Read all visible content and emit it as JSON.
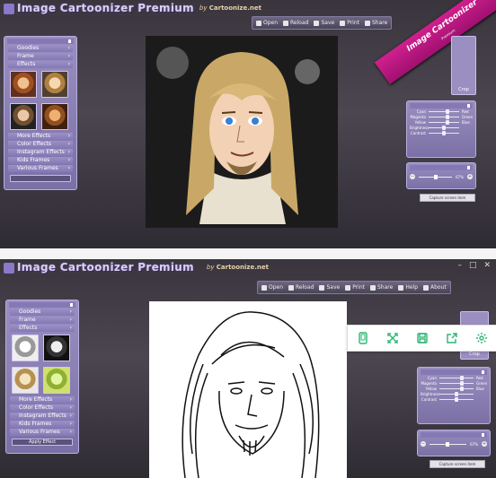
{
  "app": {
    "title": "Image Cartoonizer Premium",
    "by_label": "by",
    "by_site": "Cartoonize.net",
    "window_controls": [
      "–",
      "□",
      "✕"
    ]
  },
  "top": {
    "toolbar": [
      "Open",
      "Reload",
      "Save",
      "Print",
      "Share"
    ],
    "ribbon": {
      "title": "Image Cartoonizer",
      "subtitle": "Premium"
    },
    "left_panel": {
      "menu_upper": [
        "Goodies",
        "Frame",
        "Effects"
      ],
      "menu_lower": [
        "More Effects",
        "Color Effects",
        "Instagram Effects",
        "Kids Frames",
        "Various Frames"
      ]
    },
    "crop_label": "Crop",
    "color_sliders": [
      {
        "left": "Cyan",
        "right": "Red",
        "value": 0.55
      },
      {
        "left": "Magenta",
        "right": "Green",
        "value": 0.55
      },
      {
        "left": "Yellow",
        "right": "Blue",
        "value": 0.55
      },
      {
        "left": "Brightness",
        "right": "",
        "value": 0.45
      },
      {
        "left": "Contrast",
        "right": "",
        "value": 0.45
      }
    ],
    "zoom_value": "67%",
    "capture_label": "Capture screen item"
  },
  "bottom": {
    "toolbar": [
      "Open",
      "Reload",
      "Save",
      "Print",
      "Share",
      "Help",
      "About"
    ],
    "left_panel": {
      "menu_upper": [
        "Goodies",
        "Frame",
        "Effects"
      ],
      "menu_lower": [
        "More Effects",
        "Color Effects",
        "Instagram Effects",
        "Kids Frames",
        "Various Frames"
      ],
      "apply_label": "Apply Effect"
    },
    "crop_label": "Crop",
    "color_sliders": [
      {
        "left": "Cyan",
        "right": "Red",
        "value": 0.6
      },
      {
        "left": "Magenta",
        "right": "Green",
        "value": 0.6
      },
      {
        "left": "Yellow",
        "right": "Blue",
        "value": 0.6
      },
      {
        "left": "Brightness",
        "right": "",
        "value": 0.45
      },
      {
        "left": "Contrast",
        "right": "",
        "value": 0.45
      }
    ],
    "zoom_value": "67%",
    "capture_label": "Capture screen item"
  },
  "share_bar": {
    "icons": [
      "phone-icon",
      "fullscreen-icon",
      "save-icon",
      "share-icon",
      "settings-icon"
    ],
    "accent": "#2bb673"
  },
  "colors": {
    "panel": "#8a7fb8",
    "window": "#3e3944",
    "ribbon": "#c0188a"
  }
}
